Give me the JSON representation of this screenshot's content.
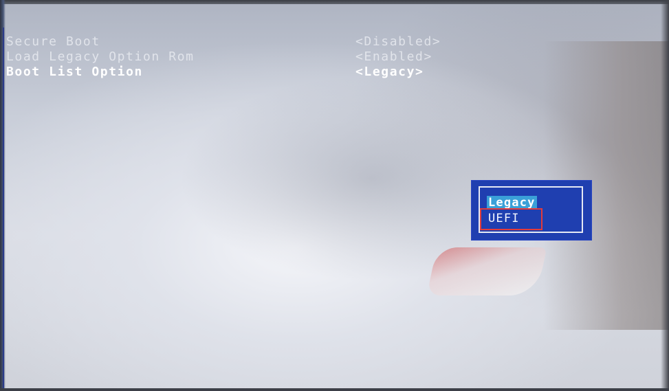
{
  "bios": {
    "settings": [
      {
        "label": "Secure Boot",
        "value": "<Disabled>"
      },
      {
        "label": "Load Legacy Option Rom",
        "value": "<Enabled>"
      },
      {
        "label": "Boot List Option",
        "value": "<Legacy>"
      }
    ],
    "popup": {
      "options": [
        "Legacy",
        "UEFI"
      ],
      "selected": "Legacy",
      "highlighted": "UEFI"
    }
  },
  "colors": {
    "popup_background": "#1f3fb0",
    "selection_bar": "#3aa0d8",
    "annotation_box": "#e23b3b",
    "text": "#ffffff"
  }
}
